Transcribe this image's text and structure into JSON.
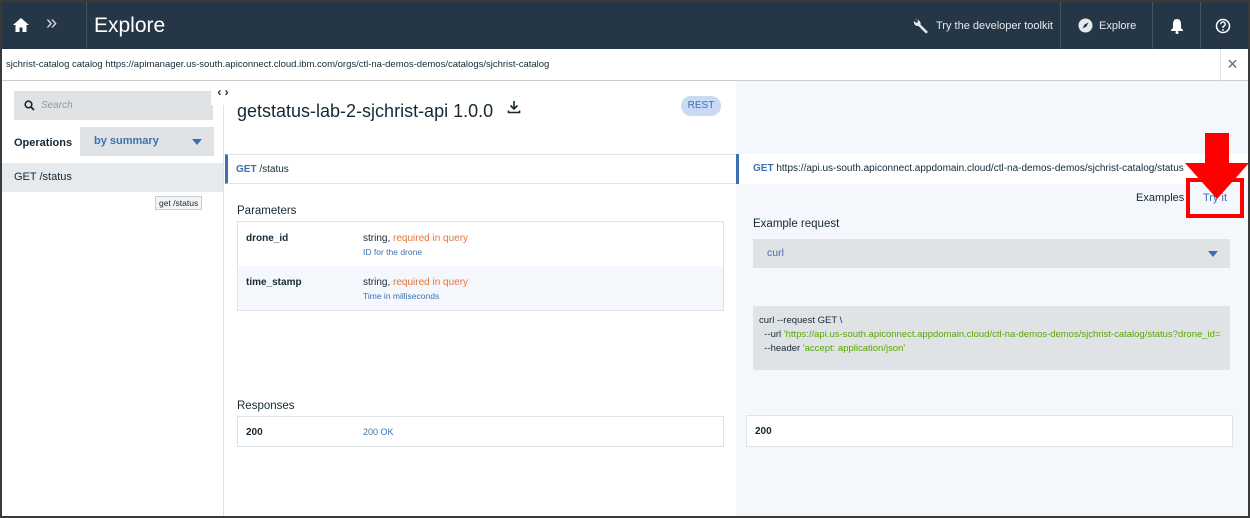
{
  "topbar": {
    "title": "Explore",
    "toolkit_label": "Try the developer toolkit",
    "explore_label": "Explore"
  },
  "urlbar": {
    "text": "sjchrist-catalog catalog https://apimanager.us-south.apiconnect.cloud.ibm.com/orgs/ctl-na-demos-demos/catalogs/sjchrist-catalog",
    "close": "×"
  },
  "sidebar": {
    "search_placeholder": "Search",
    "operations_label": "Operations",
    "sort_value": "by summary",
    "operation": "GET /status",
    "tooltip": "get /status",
    "collapse": "‹ ›"
  },
  "api": {
    "title": "getstatus-lab-2-sjchrist-api 1.0.0",
    "badge": "REST",
    "method": "GET",
    "path": "/status"
  },
  "parameters": {
    "title": "Parameters",
    "rows": [
      {
        "name": "drone_id",
        "type": "string, ",
        "req": "required in query",
        "desc": "ID for the drone"
      },
      {
        "name": "time_stamp",
        "type": "string, ",
        "req": "required in query",
        "desc": "Time in milliseconds"
      }
    ]
  },
  "responses": {
    "title": "Responses",
    "code": "200",
    "desc": "200 OK"
  },
  "right": {
    "method": "GET",
    "url": "https://api.us-south.apiconnect.appdomain.cloud/ctl-na-demos-demos/sjchrist-catalog/status",
    "examples_label": "Examples",
    "tryit_label": "Try it",
    "example_request_label": "Example request",
    "example_select": "curl",
    "code_line1": "curl --request GET \\",
    "code_line2_prefix": "  --url ",
    "code_line2_value": "'https://api.us-south.apiconnect.appdomain.cloud/ctl-na-demos-demos/sjchrist-catalog/status?drone_id=",
    "code_line3_prefix": "  --header ",
    "code_line3_value": "'accept: application/json'",
    "response_code": "200"
  },
  "colors": {
    "topbar": "#253746",
    "accent": "#3d70b2",
    "required": "#e8743b",
    "annotation": "#ff0000"
  }
}
